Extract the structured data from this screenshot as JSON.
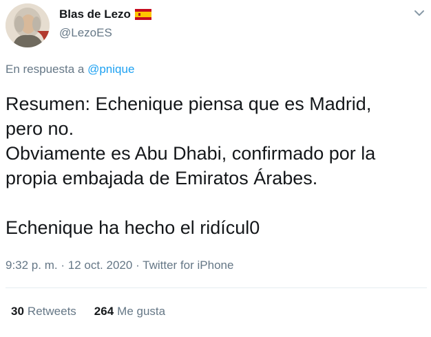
{
  "author": {
    "display_name": "Blas de Lezo",
    "handle": "@LezoES",
    "flag_icon": "spain-flag-icon"
  },
  "reply": {
    "prefix": "En respuesta a",
    "mention": "@pnique"
  },
  "tweet": {
    "lines": [
      "Resumen: Echenique piensa que es Madrid,",
      "pero no.",
      "Obviamente es Abu Dhabi, confirmado por la",
      "propia embajada de Emiratos Árabes.",
      "",
      "Echenique ha hecho el ridícul0"
    ]
  },
  "meta": {
    "time": "9:32 p. m.",
    "separator1": "·",
    "date": "12 oct. 2020",
    "separator2": "·",
    "source": "Twitter for iPhone"
  },
  "stats": {
    "retweets_count": "30",
    "retweets_label": "Retweets",
    "likes_count": "264",
    "likes_label": "Me gusta"
  },
  "colors": {
    "text": "#14171a",
    "secondary": "#657786",
    "link": "#1da1f2",
    "divider": "#e6ecf0"
  }
}
